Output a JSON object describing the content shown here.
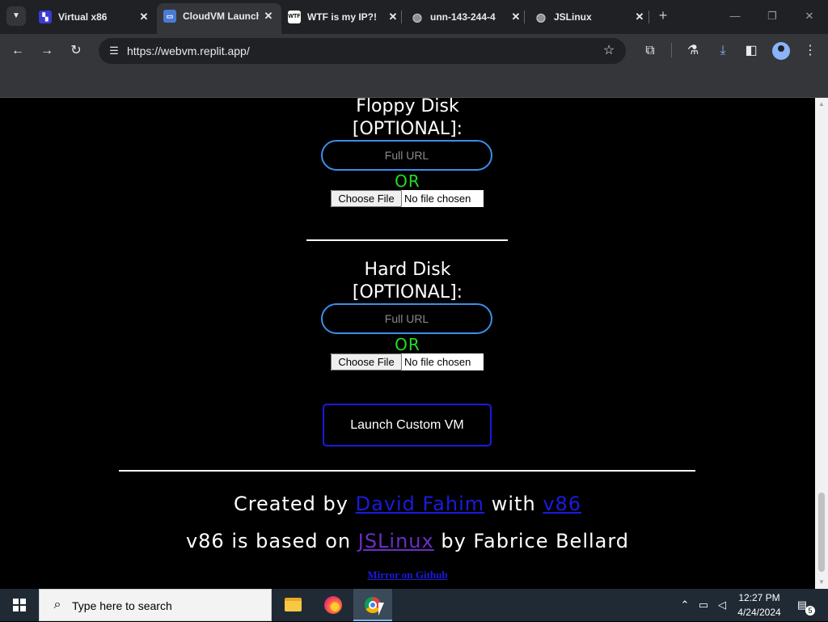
{
  "browser": {
    "tabs": [
      {
        "title": "Virtual x86",
        "active": false,
        "favicon": "virtual-x86-favicon"
      },
      {
        "title": "CloudVM Launcher",
        "active": true,
        "favicon": "cloudvm-favicon"
      },
      {
        "title": "WTF is my IP?!",
        "active": false,
        "favicon": "wtf-favicon"
      },
      {
        "title": "unn-143-244-4",
        "active": false,
        "favicon": "globe-favicon"
      },
      {
        "title": "JSLinux",
        "active": false,
        "favicon": "globe-favicon"
      }
    ],
    "url": "https://webvm.replit.app/",
    "wtf_favicon_text": "WTF"
  },
  "page": {
    "floppy": {
      "title_line1": "Floppy Disk",
      "title_line2": "[OPTIONAL]:",
      "url_placeholder": "Full URL",
      "or_label": "OR",
      "choose_file_label": "Choose File",
      "no_file_label": "No file chosen"
    },
    "hard_disk": {
      "title_line1": "Hard Disk",
      "title_line2": "[OPTIONAL]:",
      "url_placeholder": "Full URL",
      "or_label": "OR",
      "choose_file_label": "Choose File",
      "no_file_label": "No file chosen"
    },
    "launch_button_label": "Launch Custom VM",
    "credits": {
      "line1_prefix": "Created by ",
      "author_link": "David Fahim",
      "line1_mid": " with ",
      "v86_link": "v86",
      "line2_prefix": "v86 is based on ",
      "jslinux_link": "JSLinux",
      "line2_suffix": " by Fabrice Bellard"
    },
    "mirror_link": "Mirror on Github"
  },
  "taskbar": {
    "search_placeholder": "Type here to search",
    "time": "12:27 PM",
    "date": "4/24/2024",
    "notification_count": "5"
  },
  "colors": {
    "page_bg": "#000000",
    "input_border": "#3b8eea",
    "or_green": "#22dd22",
    "link_blue": "#1a1adf",
    "link_visited": "#6a2ec5"
  }
}
